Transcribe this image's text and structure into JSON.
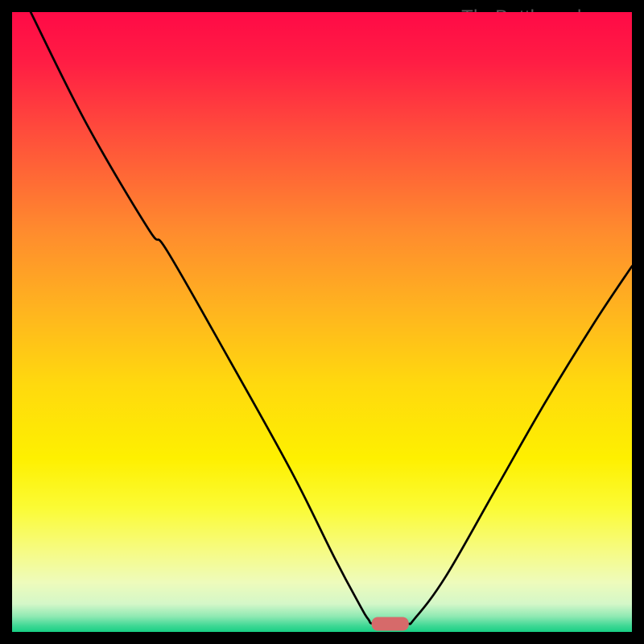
{
  "watermark": "TheBottleneck.com",
  "chart_data": {
    "type": "line",
    "title": "",
    "xlabel": "",
    "ylabel": "",
    "xlim": [
      0,
      100
    ],
    "ylim": [
      0,
      100
    ],
    "grid": false,
    "legend": false,
    "background": {
      "type": "vertical-gradient",
      "stops": [
        {
          "offset": 0.0,
          "color": "#ff0a46"
        },
        {
          "offset": 0.08,
          "color": "#ff1d44"
        },
        {
          "offset": 0.2,
          "color": "#ff4f3b"
        },
        {
          "offset": 0.35,
          "color": "#ff8a2e"
        },
        {
          "offset": 0.48,
          "color": "#ffb41f"
        },
        {
          "offset": 0.6,
          "color": "#ffd90e"
        },
        {
          "offset": 0.72,
          "color": "#fef000"
        },
        {
          "offset": 0.8,
          "color": "#fbfb35"
        },
        {
          "offset": 0.87,
          "color": "#f6fb84"
        },
        {
          "offset": 0.92,
          "color": "#eefbbb"
        },
        {
          "offset": 0.955,
          "color": "#d4f7c8"
        },
        {
          "offset": 0.975,
          "color": "#8fe9b3"
        },
        {
          "offset": 0.99,
          "color": "#3fd895"
        },
        {
          "offset": 1.0,
          "color": "#18cf84"
        }
      ]
    },
    "series": [
      {
        "name": "bottleneck-curve",
        "color": "#000000",
        "width": 2.2,
        "points": [
          {
            "x": 3.0,
            "y": 100.0
          },
          {
            "x": 12.0,
            "y": 82.0
          },
          {
            "x": 22.0,
            "y": 65.0
          },
          {
            "x": 25.0,
            "y": 61.5
          },
          {
            "x": 35.0,
            "y": 44.0
          },
          {
            "x": 45.0,
            "y": 26.0
          },
          {
            "x": 52.0,
            "y": 12.0
          },
          {
            "x": 56.0,
            "y": 4.5
          },
          {
            "x": 57.5,
            "y": 2.0
          },
          {
            "x": 58.5,
            "y": 1.3
          },
          {
            "x": 63.5,
            "y": 1.3
          },
          {
            "x": 65.0,
            "y": 2.2
          },
          {
            "x": 70.0,
            "y": 9.0
          },
          {
            "x": 78.0,
            "y": 23.0
          },
          {
            "x": 86.0,
            "y": 37.0
          },
          {
            "x": 94.0,
            "y": 50.0
          },
          {
            "x": 100.0,
            "y": 59.0
          }
        ]
      }
    ],
    "marker": {
      "name": "optimal-point",
      "shape": "rounded-rect",
      "color": "#d66a6a",
      "cx": 61.0,
      "cy": 1.3,
      "w": 6.0,
      "h": 2.2
    }
  }
}
